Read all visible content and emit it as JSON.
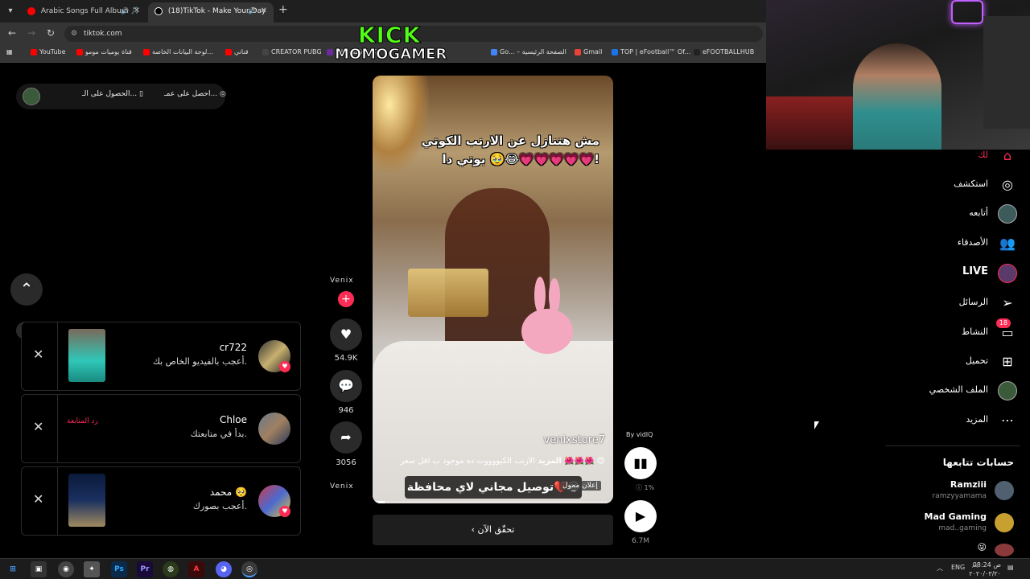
{
  "browser": {
    "tabs": [
      {
        "title": "Arabic Songs Full Album 🎵",
        "favicon_color": "#ff0000"
      },
      {
        "title": "(18)TikTok - Make Your Day",
        "favicon_color": "#000000"
      }
    ],
    "new_tab": "+",
    "url": "tiktok.com",
    "bookmarks": [
      {
        "label": "YouTube",
        "color": "#ff0000"
      },
      {
        "label": "قناة يوميات مومو",
        "color": "#ff0000"
      },
      {
        "label": "لوحة البيانات الخاصة...",
        "color": "#ff0000"
      },
      {
        "label": "قناتي",
        "color": "#ff0000"
      },
      {
        "label": "CREATOR PUBG",
        "color": "#444444"
      },
      {
        "label": "كيف تكتب على",
        "color": "#6a2aa0"
      },
      {
        "label": "Go... – الصفحة الرئيسية",
        "color": "#4285f4"
      },
      {
        "label": "Gmail",
        "color": "#ea4335"
      },
      {
        "label": "TOP | eFootball™ Of...",
        "color": "#1a73e8"
      },
      {
        "label": "eFOOTBALLHUB",
        "color": "#222222"
      }
    ]
  },
  "overlay": {
    "kick_logo": "KICK",
    "streamer": "MOMOGAMER"
  },
  "left_panel": {
    "pill_item_1": "احصل على عمـ...",
    "pill_item_2": "الحصول على الـ...",
    "up_icon": "⌃"
  },
  "notifications": [
    {
      "name": "cr722",
      "message": "أعجب بالفيديو الخاص بك.",
      "close": "✕",
      "action": ""
    },
    {
      "name": "Chloe",
      "message": "بدأ في متابعتك.",
      "close": "✕",
      "action": "رد المتابعة"
    },
    {
      "name": "محمد 🥺",
      "message": "أعجب بصورك.",
      "close": "✕",
      "action": ""
    }
  ],
  "video": {
    "caption_line_1": "مش هتنازل عن الارنب الكوتي",
    "caption_line_2": "بوتي دا 🥹😂💗💗💗💗💗!",
    "watermark": "venixstore7",
    "description": "الأرنب الكيووووت ده موجود ب اقل سعر 🌺🌺🌺 😍",
    "more": "المزيد",
    "subtitle": "توصيل مجاني لاي محافظة❤️😍",
    "ad_label": "إعلان ممول",
    "progress": 0.05
  },
  "cta": {
    "label": "تحقّق الآن"
  },
  "actions": {
    "brand": "Venix",
    "likes": "54.9K",
    "comments": "946",
    "shares": "3056"
  },
  "controls": {
    "by": "By vidIQ",
    "percent": "1%",
    "views": "6.7M"
  },
  "sidebar": {
    "items": [
      {
        "label": "لك",
        "icon": "home-icon"
      },
      {
        "label": "استكشف",
        "icon": "compass-icon"
      },
      {
        "label": "أتابعه",
        "icon": "following-icon"
      },
      {
        "label": "الأصدقاء",
        "icon": "friends-icon"
      },
      {
        "label": "LIVE",
        "icon": "live-icon"
      },
      {
        "label": "الرسائل",
        "icon": "messages-icon"
      },
      {
        "label": "النشاط",
        "icon": "activity-icon",
        "badge": "18"
      },
      {
        "label": "تحميل",
        "icon": "upload-icon"
      },
      {
        "label": "الملف الشخصي",
        "icon": "profile-icon"
      },
      {
        "label": "المزيد",
        "icon": "more-icon"
      }
    ],
    "following_title": "حسابات تتابعها",
    "following": [
      {
        "name": "Ramziii",
        "handle": "ramzyyamama"
      },
      {
        "name": "Mad Gaming",
        "handle": "mad..gaming"
      },
      {
        "name": "😜",
        "handle": ""
      }
    ]
  },
  "taskbar": {
    "lang": "ENG",
    "time": "08:24 ص",
    "date": "٢٠٢٠/٠٣/٢٠"
  }
}
